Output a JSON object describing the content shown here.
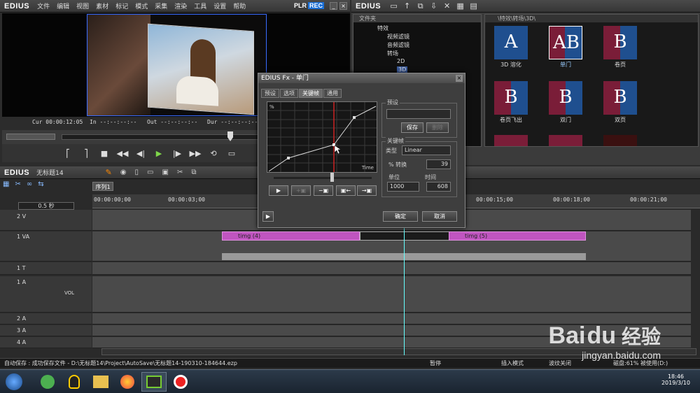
{
  "app": {
    "logo": "EDIUS",
    "menu": [
      "文件",
      "编辑",
      "视图",
      "素材",
      "标记",
      "模式",
      "采集",
      "渲染",
      "工具",
      "设置",
      "帮助"
    ],
    "plr": "PLR",
    "rec": "REC"
  },
  "monitor": {
    "cur_label": "Cur",
    "cur": "00:00:12:05",
    "in_label": "In",
    "in": "--:--:--:--",
    "out_label": "Out",
    "out": "--:--:--:--",
    "dur_label": "Dur",
    "dur": "--:--:--:--"
  },
  "effects": {
    "tree_header": "文件夹",
    "tree": [
      "特效",
      "视频滤镜",
      "音频滤镜",
      "转场",
      "2D",
      "3D"
    ],
    "grid_header": "\\特效\\转场\\3D\\",
    "items": [
      "3D 溶化",
      "单门",
      "卷页",
      "卷页飞出",
      "双门",
      "双页"
    ]
  },
  "timeline": {
    "project_label": "EDIUS",
    "project_name": "无标题14",
    "sequence_tab": "序列1",
    "zoom": "0.5 秒",
    "ruler": [
      "00:00:00;00",
      "00:00:03;00",
      "00:00:15;00",
      "00:00:18;00",
      "00:00:21;00"
    ],
    "tracks": [
      {
        "name": "2 V"
      },
      {
        "name": "1 VA"
      },
      {
        "name": "1 T"
      },
      {
        "name": "1 A",
        "vol": "VOL"
      },
      {
        "name": "2 A"
      },
      {
        "name": "3 A"
      },
      {
        "name": "4 A"
      }
    ],
    "clips": [
      "timg (4)",
      "timg (5)"
    ]
  },
  "status": {
    "autosave": "自动保存 : 成功保存文件 - D:\\无标题14\\Project\\AutoSave\\无标题14-190310-184644.ezp",
    "pause": "暂停",
    "insert": "插入模式",
    "ripple": "波纹关闭",
    "disk": "磁盘:61% 被使用(D:)"
  },
  "dialog": {
    "title": "EDIUS Fx - 单门",
    "tabs": [
      "预设",
      "选项",
      "关键帧",
      "通用"
    ],
    "active_tab": "关键帧",
    "graph_y": "%",
    "graph_x": "Time",
    "preset_title": "预设",
    "save": "保存",
    "delete": "删除",
    "keyframe_title": "关键帧",
    "type_label": "类型",
    "type_value": "Linear",
    "percent_label": "% 转换",
    "percent_value": "39",
    "unit_label": "单位",
    "unit_value": "1000",
    "time_label": "时间",
    "time_value": "608",
    "ok": "确定",
    "cancel": "取消"
  },
  "taskbar": {
    "time": "18:46",
    "date": "2019/3/10"
  },
  "watermark": {
    "brand": "Bai",
    "brand2": "du",
    "sub": "经验",
    "url": "jingyan.baidu.com"
  }
}
